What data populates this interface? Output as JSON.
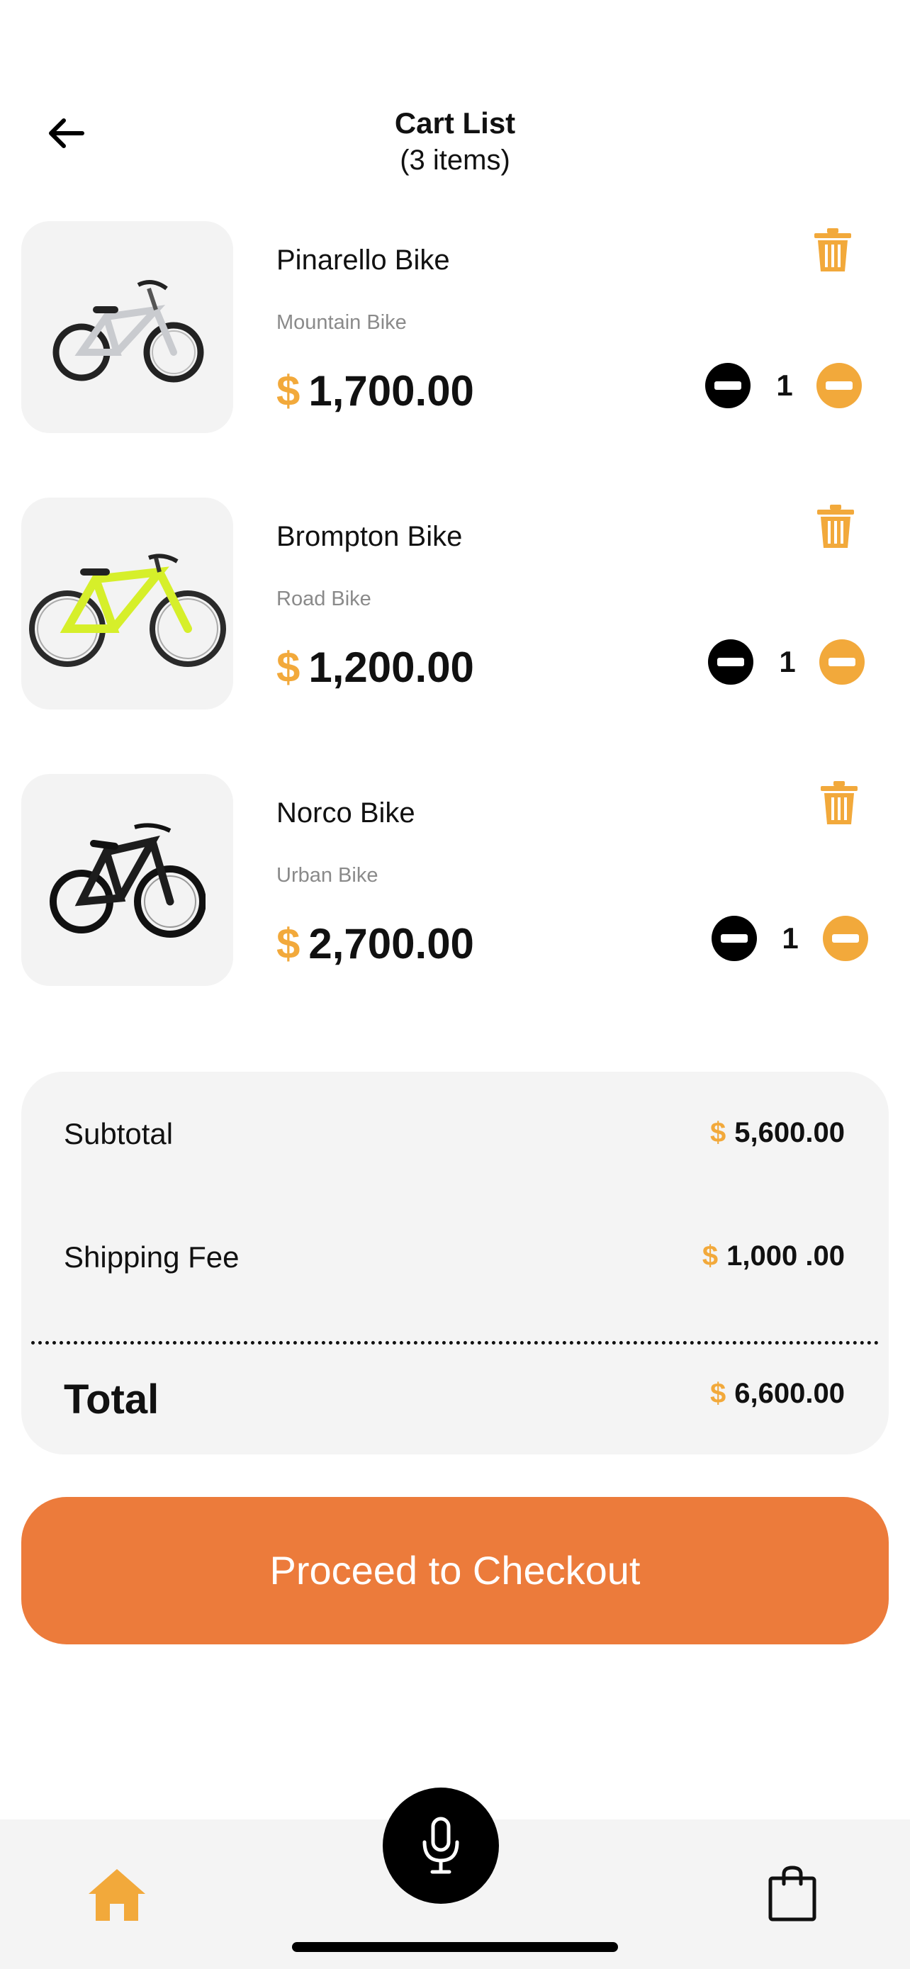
{
  "header": {
    "title": "Cart List",
    "subtitle": "(3 items)"
  },
  "items": [
    {
      "name": "Pinarello Bike",
      "category": "Mountain Bike",
      "currency": "$",
      "price": "1,700.00",
      "quantity": "1",
      "frame_color": "#c9cbcf"
    },
    {
      "name": "Brompton Bike",
      "category": "Road Bike",
      "currency": "$",
      "price": "1,200.00",
      "quantity": "1",
      "frame_color": "#d6ef2a"
    },
    {
      "name": "Norco Bike",
      "category": "Urban Bike",
      "currency": "$",
      "price": "2,700.00",
      "quantity": "1",
      "frame_color": "#1d1d1d"
    }
  ],
  "summary": {
    "subtotal_label": "Subtotal",
    "subtotal_currency": "$",
    "subtotal_value": "5,600.00",
    "shipping_label": "Shipping Fee",
    "shipping_currency": "$",
    "shipping_value": "1,000 .00",
    "total_label": "Total",
    "total_currency": "$",
    "total_value": "6,600.00"
  },
  "checkout": {
    "label": "Proceed to Checkout"
  },
  "nav": {
    "home_icon": "home-icon",
    "mic_icon": "microphone-icon",
    "bag_icon": "shopping-bag-icon"
  },
  "colors": {
    "accent": "#F2A93B",
    "checkout": "#EC7B3B",
    "panel": "#f4f4f4"
  }
}
